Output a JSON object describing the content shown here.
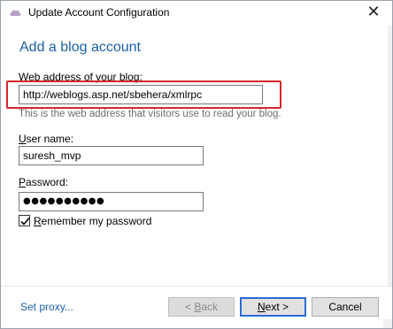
{
  "window": {
    "title": "Update Account Configuration",
    "close_glyph": "✕",
    "app_icon": "cloud-icon"
  },
  "form": {
    "heading": "Add a blog account",
    "web_address_label_pre": "",
    "web_address_label_u": "W",
    "web_address_label_post": "eb address of your blog:",
    "web_address_value": "http://weblogs.asp.net/sbehera/xmlrpc",
    "web_address_hint": "This is the web address that visitors use to read your blog.",
    "username_label_u": "U",
    "username_label_post": "ser name:",
    "username_value": "suresh_mvp",
    "password_label_u": "P",
    "password_label_post": "assword:",
    "password_mask": "●●●●●●●●●●",
    "remember_label_u": "R",
    "remember_label_post": "emember my password",
    "remember_checked": true
  },
  "footer": {
    "proxy_link": "Set proxy...",
    "back_prefix": "< ",
    "back_u": "B",
    "back_post": "ack",
    "next_u": "N",
    "next_post": "ext >",
    "cancel_label": "Cancel"
  },
  "colors": {
    "heading": "#1b5fa8",
    "highlight": "#d7262b",
    "link": "#1b5fa8",
    "app_icon": "#b8a0c8"
  }
}
